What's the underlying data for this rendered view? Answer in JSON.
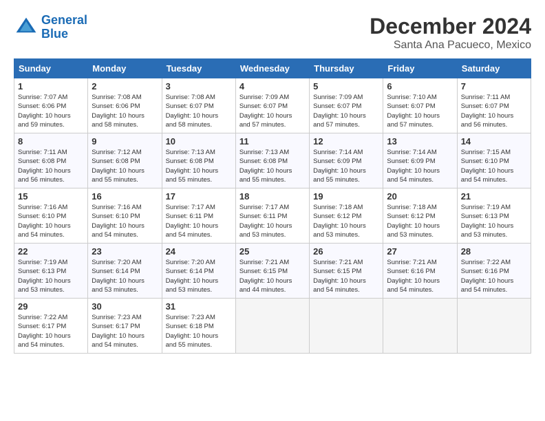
{
  "logo": {
    "line1": "General",
    "line2": "Blue"
  },
  "title": "December 2024",
  "location": "Santa Ana Pacueco, Mexico",
  "days_of_week": [
    "Sunday",
    "Monday",
    "Tuesday",
    "Wednesday",
    "Thursday",
    "Friday",
    "Saturday"
  ],
  "weeks": [
    [
      {
        "day": "1",
        "info": "Sunrise: 7:07 AM\nSunset: 6:06 PM\nDaylight: 10 hours\nand 59 minutes."
      },
      {
        "day": "2",
        "info": "Sunrise: 7:08 AM\nSunset: 6:06 PM\nDaylight: 10 hours\nand 58 minutes."
      },
      {
        "day": "3",
        "info": "Sunrise: 7:08 AM\nSunset: 6:07 PM\nDaylight: 10 hours\nand 58 minutes."
      },
      {
        "day": "4",
        "info": "Sunrise: 7:09 AM\nSunset: 6:07 PM\nDaylight: 10 hours\nand 57 minutes."
      },
      {
        "day": "5",
        "info": "Sunrise: 7:09 AM\nSunset: 6:07 PM\nDaylight: 10 hours\nand 57 minutes."
      },
      {
        "day": "6",
        "info": "Sunrise: 7:10 AM\nSunset: 6:07 PM\nDaylight: 10 hours\nand 57 minutes."
      },
      {
        "day": "7",
        "info": "Sunrise: 7:11 AM\nSunset: 6:07 PM\nDaylight: 10 hours\nand 56 minutes."
      }
    ],
    [
      {
        "day": "8",
        "info": "Sunrise: 7:11 AM\nSunset: 6:08 PM\nDaylight: 10 hours\nand 56 minutes."
      },
      {
        "day": "9",
        "info": "Sunrise: 7:12 AM\nSunset: 6:08 PM\nDaylight: 10 hours\nand 55 minutes."
      },
      {
        "day": "10",
        "info": "Sunrise: 7:13 AM\nSunset: 6:08 PM\nDaylight: 10 hours\nand 55 minutes."
      },
      {
        "day": "11",
        "info": "Sunrise: 7:13 AM\nSunset: 6:08 PM\nDaylight: 10 hours\nand 55 minutes."
      },
      {
        "day": "12",
        "info": "Sunrise: 7:14 AM\nSunset: 6:09 PM\nDaylight: 10 hours\nand 55 minutes."
      },
      {
        "day": "13",
        "info": "Sunrise: 7:14 AM\nSunset: 6:09 PM\nDaylight: 10 hours\nand 54 minutes."
      },
      {
        "day": "14",
        "info": "Sunrise: 7:15 AM\nSunset: 6:10 PM\nDaylight: 10 hours\nand 54 minutes."
      }
    ],
    [
      {
        "day": "15",
        "info": "Sunrise: 7:16 AM\nSunset: 6:10 PM\nDaylight: 10 hours\nand 54 minutes."
      },
      {
        "day": "16",
        "info": "Sunrise: 7:16 AM\nSunset: 6:10 PM\nDaylight: 10 hours\nand 54 minutes."
      },
      {
        "day": "17",
        "info": "Sunrise: 7:17 AM\nSunset: 6:11 PM\nDaylight: 10 hours\nand 54 minutes."
      },
      {
        "day": "18",
        "info": "Sunrise: 7:17 AM\nSunset: 6:11 PM\nDaylight: 10 hours\nand 53 minutes."
      },
      {
        "day": "19",
        "info": "Sunrise: 7:18 AM\nSunset: 6:12 PM\nDaylight: 10 hours\nand 53 minutes."
      },
      {
        "day": "20",
        "info": "Sunrise: 7:18 AM\nSunset: 6:12 PM\nDaylight: 10 hours\nand 53 minutes."
      },
      {
        "day": "21",
        "info": "Sunrise: 7:19 AM\nSunset: 6:13 PM\nDaylight: 10 hours\nand 53 minutes."
      }
    ],
    [
      {
        "day": "22",
        "info": "Sunrise: 7:19 AM\nSunset: 6:13 PM\nDaylight: 10 hours\nand 53 minutes."
      },
      {
        "day": "23",
        "info": "Sunrise: 7:20 AM\nSunset: 6:14 PM\nDaylight: 10 hours\nand 53 minutes."
      },
      {
        "day": "24",
        "info": "Sunrise: 7:20 AM\nSunset: 6:14 PM\nDaylight: 10 hours\nand 53 minutes."
      },
      {
        "day": "25",
        "info": "Sunrise: 7:21 AM\nSunset: 6:15 PM\nDaylight: 10 hours\nand 44 minutes."
      },
      {
        "day": "26",
        "info": "Sunrise: 7:21 AM\nSunset: 6:15 PM\nDaylight: 10 hours\nand 54 minutes."
      },
      {
        "day": "27",
        "info": "Sunrise: 7:21 AM\nSunset: 6:16 PM\nDaylight: 10 hours\nand 54 minutes."
      },
      {
        "day": "28",
        "info": "Sunrise: 7:22 AM\nSunset: 6:16 PM\nDaylight: 10 hours\nand 54 minutes."
      }
    ],
    [
      {
        "day": "29",
        "info": "Sunrise: 7:22 AM\nSunset: 6:17 PM\nDaylight: 10 hours\nand 54 minutes."
      },
      {
        "day": "30",
        "info": "Sunrise: 7:23 AM\nSunset: 6:17 PM\nDaylight: 10 hours\nand 54 minutes."
      },
      {
        "day": "31",
        "info": "Sunrise: 7:23 AM\nSunset: 6:18 PM\nDaylight: 10 hours\nand 55 minutes."
      },
      {
        "day": "",
        "info": ""
      },
      {
        "day": "",
        "info": ""
      },
      {
        "day": "",
        "info": ""
      },
      {
        "day": "",
        "info": ""
      }
    ]
  ]
}
